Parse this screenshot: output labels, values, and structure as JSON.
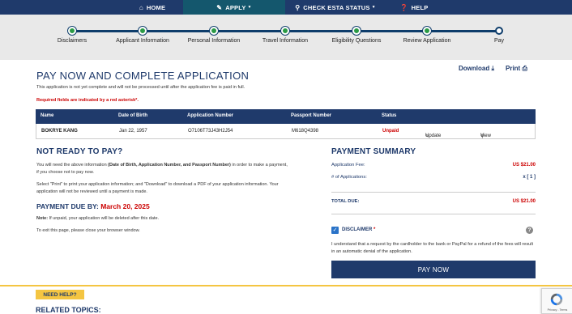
{
  "nav": {
    "home": "HOME",
    "apply": "APPLY",
    "check": "CHECK ESTA STATUS",
    "help": "HELP"
  },
  "progress": {
    "steps": [
      "Disclaimers",
      "Applicant Information",
      "Personal Information",
      "Travel Information",
      "Eligibility Questions",
      "Review Application",
      "Pay"
    ],
    "current_step": 7
  },
  "page": {
    "title": "PAY NOW AND COMPLETE APPLICATION",
    "download": "Download",
    "print": "Print",
    "intro": "This application is not yet complete and will not be processed until after the application fee is paid in full.",
    "required": "Required fields are indicated by a red asterisk*."
  },
  "table": {
    "headers": [
      "Name",
      "Date of Birth",
      "Application Number",
      "Passport Number",
      "Status"
    ],
    "rows": [
      {
        "name": "BOKRYE KANG",
        "dob": "Jan 22, 1957",
        "app_no": "O7106T73J43H2J54",
        "passport": "M618Q4398",
        "status": "Unpaid",
        "update": "Update",
        "view": "View"
      }
    ]
  },
  "not_ready": {
    "heading": "NOT READY TO PAY?",
    "para1_pre": "You will need the above information ",
    "para1_bold": "(Date of Birth, Application Number, and Passport Number)",
    "para1_post": " in order to make a payment, if you choose not to pay now.",
    "para2": "Select \"Print\" to print your application information; and \"Download\" to download a PDF of your application information. Your application will not be reviewed until a payment is made.",
    "due_label": "PAYMENT DUE BY:",
    "due_date": "March 20, 2025",
    "note_bold": "Note:",
    "note_text": " If unpaid, your application will be deleted after this date.",
    "exit": "To exit this page, please close your browser window."
  },
  "summary": {
    "heading": "PAYMENT SUMMARY",
    "fee_label": "Application Fee:",
    "fee_value": "US $21.00",
    "count_label": "# of Applications:",
    "count_value": "x [ 1 ]",
    "total_label": "TOTAL DUE:",
    "total_value": "US $21.00",
    "disclaimer_label": "DISCLAIMER",
    "disclaimer_text": "I understand that a request by the cardholder to the bank or PayPal for a refund of the fees will result in an automatic denial of the application.",
    "pay_button": "PAY NOW"
  },
  "footer": {
    "need_help": "NEED HELP?",
    "related": "RELATED TOPICS:",
    "recaptcha": "Privacy - Terms"
  },
  "colors": {
    "navy": "#1f3a6b",
    "teal": "#14576d",
    "red": "#cc0000",
    "green": "#2a9a45",
    "yellow": "#f4c542"
  }
}
